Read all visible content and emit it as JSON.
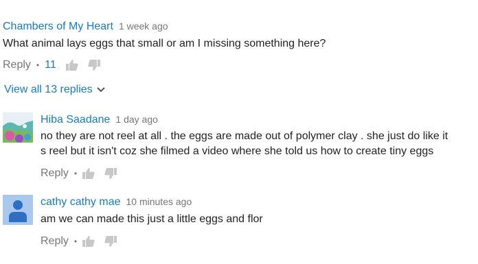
{
  "top_comment": {
    "author": "Chambers of My Heart",
    "timestamp": "1 week ago",
    "text": "What animal lays eggs that small or am I missing something here?",
    "reply_label": "Reply",
    "separator": "•",
    "like_count": "11",
    "view_replies_label": "View all 13 replies"
  },
  "replies": [
    {
      "author": "Hiba Saadane",
      "timestamp": "1 day ago",
      "text_line1": "no they are not reel at all . the eggs are made out of polymer clay . she just do like it",
      "text_line2": "s reel but it isn't coz she filmed a video where she told us how to create tiny eggs",
      "reply_label": "Reply",
      "separator": "•"
    },
    {
      "author": "cathy cathy mae",
      "timestamp": "10 minutes ago",
      "text": "am we can made this just a little eggs and flor",
      "reply_label": "Reply",
      "separator": "•"
    }
  ],
  "colors": {
    "author_link": "#167ac6",
    "meta_gray": "#767676",
    "text": "#222222",
    "default_avatar_bg": "#aac8ee",
    "default_avatar_fg": "#2f6fc3"
  },
  "icons": [
    "thumbs-up-icon",
    "thumbs-down-icon",
    "chevron-down-icon",
    "default-avatar-icon"
  ]
}
